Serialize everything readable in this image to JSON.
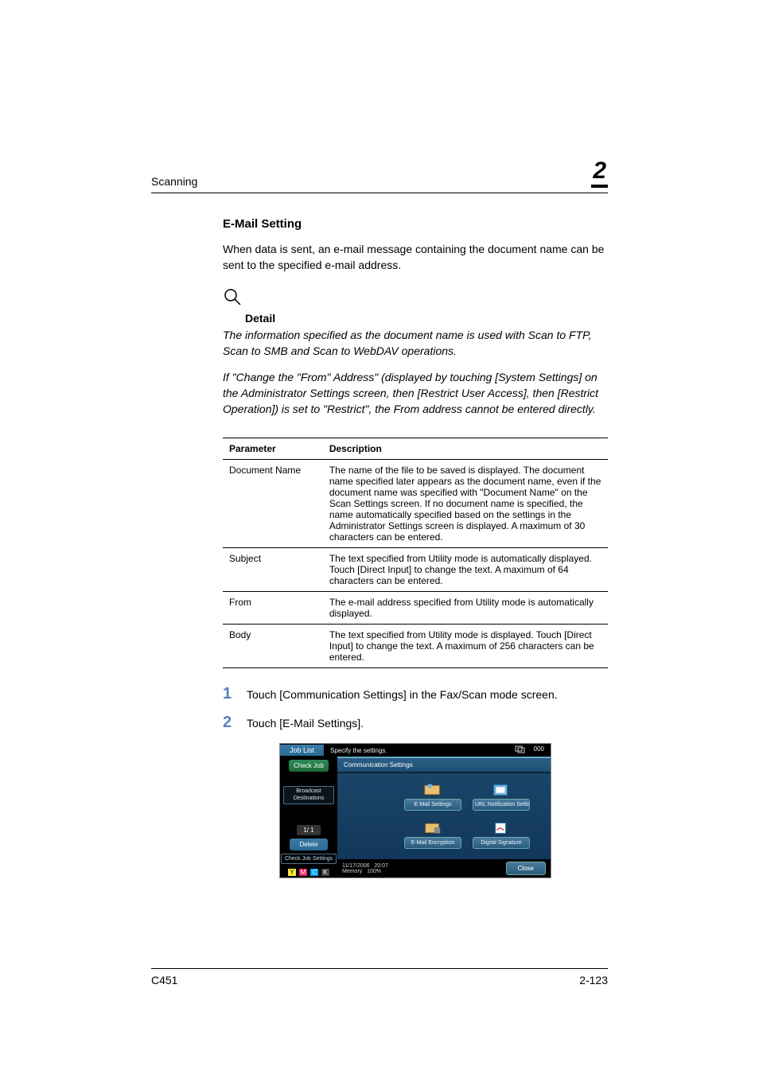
{
  "header": {
    "section": "Scanning",
    "chapter_number": "2"
  },
  "section_title": "E-Mail Setting",
  "intro_paragraph": "When data is sent, an e-mail message containing the document name can be sent to the specified e-mail address.",
  "detail": {
    "heading": "Detail",
    "para1": "The information specified as the document name is used with Scan to FTP, Scan to SMB and Scan to WebDAV operations.",
    "para2": "If \"Change the \"From\" Address\" (displayed by touching [System Settings] on the Administrator Settings screen, then [Restrict User Access], then [Restrict Operation]) is set to \"Restrict\", the From address cannot be entered directly."
  },
  "table": {
    "headers": {
      "param": "Parameter",
      "desc": "Description"
    },
    "rows": [
      {
        "param": "Document Name",
        "desc": "The name of the file to be saved is displayed. The document name specified later appears as the document name, even if the document name was specified with \"Document Name\" on the Scan Settings screen. If no document name is specified, the name automatically specified based on the settings in the Administrator Settings screen is displayed. A maximum of 30 characters can be entered."
      },
      {
        "param": "Subject",
        "desc": "The text specified from Utility mode is automatically displayed. Touch [Direct Input] to change the text. A maximum of 64 characters can be entered."
      },
      {
        "param": "From",
        "desc": "The e-mail address specified from Utility mode is automatically displayed."
      },
      {
        "param": "Body",
        "desc": "The text specified from Utility mode is displayed. Touch [Direct Input] to change the text. A maximum of 256 characters can be entered."
      }
    ]
  },
  "steps": [
    {
      "num": "1",
      "text": "Touch [Communication Settings] in the Fax/Scan mode screen."
    },
    {
      "num": "2",
      "text": "Touch [E-Mail Settings]."
    }
  ],
  "device": {
    "job_list": "Job List",
    "top_msg": "Specify the settings.",
    "top_count": "000",
    "check_job": "Check Job",
    "broadcast": "Broadcast Destinations",
    "page_indicator": "1/ 1",
    "delete": "Delete",
    "check_job_settings": "Check Job Settings",
    "tab": "Communication Settings",
    "tiles": {
      "email_settings": "E-Mail Settings",
      "url_notif": "URL Notification Setting",
      "email_encrypt": "E-Mail Encryption",
      "digital_sig": "Digital Signature"
    },
    "footer_date": "11/17/2006",
    "footer_time": "20:07",
    "footer_mem_label": "Memory",
    "footer_mem_val": "100%",
    "close": "Close"
  },
  "footer": {
    "model": "C451",
    "page": "2-123"
  }
}
